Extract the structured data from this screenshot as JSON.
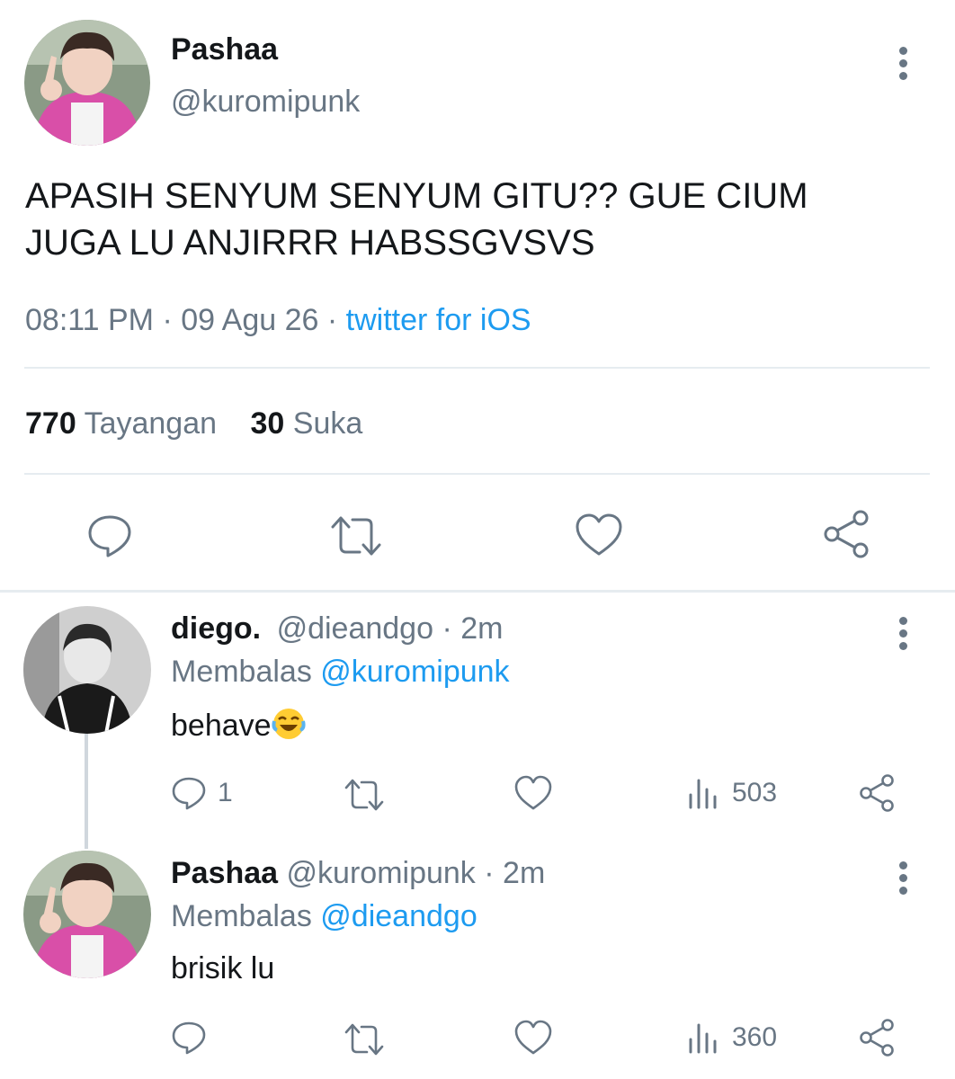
{
  "main_tweet": {
    "display_name": "Pashaa",
    "handle": "@kuromipunk",
    "text_line1": "APASIH SENYUM SENYUM GITU?? GUE CIUM",
    "text_line2": "JUGA LU ANJIRRR HABSSGVSVS",
    "time": "08:11 PM",
    "date": "09 Agu 26",
    "separator": "·",
    "source": "twitter for iOS",
    "views_count": "770",
    "views_label": "Tayangan",
    "likes_count": "30",
    "likes_label": "Suka"
  },
  "replies": [
    {
      "display_name": "diego.",
      "handle": "@dieandgo",
      "meta": "· 2m",
      "replying_prefix": "Membalas",
      "replying_to": "@kuromipunk",
      "text": "behave",
      "emoji": "😂",
      "reply_count": "1",
      "views_count": "503"
    },
    {
      "display_name": "Pashaa",
      "handle": "@kuromipunk",
      "meta": "· 2m",
      "replying_prefix": "Membalas",
      "replying_to": "@dieandgo",
      "text": "brisik lu",
      "reply_count": "",
      "views_count": "360"
    }
  ],
  "colors": {
    "accent": "#1d9bf0",
    "muted": "#687684",
    "divider": "#e6ecf0",
    "thread_line": "#d0d7dd",
    "avatar_pink": "#d94fa8"
  }
}
